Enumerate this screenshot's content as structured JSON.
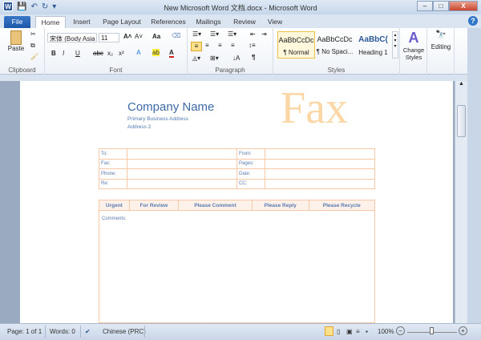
{
  "window": {
    "title": "New Microsoft Word 文档.docx - Microsoft Word",
    "minimize": "–",
    "maximize": "□",
    "close": "X"
  },
  "tabs": [
    "File",
    "Home",
    "Insert",
    "Page Layout",
    "References",
    "Mailings",
    "Review",
    "View"
  ],
  "ribbon": {
    "clipboard": {
      "label": "Clipboard",
      "paste": "Paste"
    },
    "font": {
      "label": "Font",
      "font_name": "宋体 (Body Asia",
      "font_size": "11",
      "bold": "B",
      "italic": "I",
      "underline": "U",
      "strike": "abc",
      "subscript": "x₂",
      "superscript": "x²",
      "grow": "A˄",
      "shrink": "A˅",
      "case": "Aa",
      "color": "A"
    },
    "paragraph": {
      "label": "Paragraph",
      "pilcrow": "¶"
    },
    "styles": {
      "label": "Styles",
      "items": [
        {
          "preview": "AaBbCcDc",
          "name": "¶ Normal"
        },
        {
          "preview": "AaBbCcDc",
          "name": "¶ No Spaci..."
        },
        {
          "preview": "AaBbC(",
          "name": "Heading 1"
        }
      ],
      "change_styles": "Change Styles"
    },
    "editing": {
      "label": "Editing"
    }
  },
  "document": {
    "company": "Company Name",
    "address1": "Primary Business Address",
    "address2": "Address 2",
    "fax_title": "Fax",
    "info_rows": [
      [
        "To:",
        "From:"
      ],
      [
        "Fax:",
        "Pages:"
      ],
      [
        "Phone:",
        "Date:"
      ],
      [
        "Re:",
        "CC:"
      ]
    ],
    "marks": [
      "Urgent",
      "For Review",
      "Please Comment",
      "Please Reply",
      "Please Recycle"
    ],
    "comments": "Comments:"
  },
  "status": {
    "page": "Page: 1 of 1",
    "words": "Words: 0",
    "language": "Chinese (PRC)",
    "zoom": "100%",
    "zoom_percent": 100
  }
}
